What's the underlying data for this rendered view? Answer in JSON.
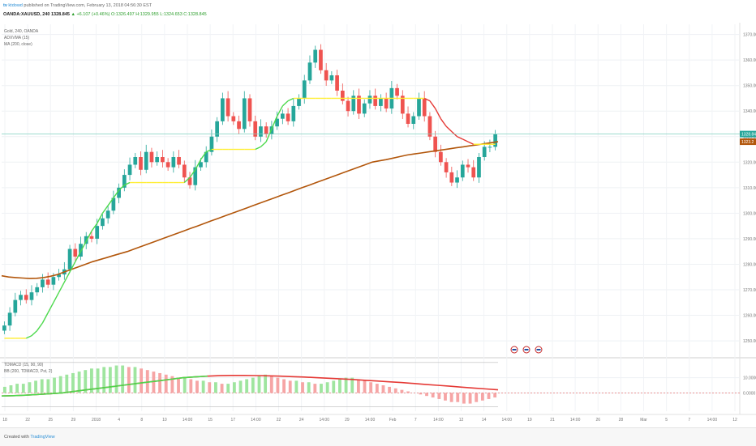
{
  "header": {
    "logo": "tv",
    "author": "ktdowd",
    "published_text": "published on TradingView.com, February 13, 2018 04:56:30 EST"
  },
  "quote": {
    "symbol": "OANDA:XAUUSD, 240",
    "open": "1328.845",
    "change": "▲ +6.107 (+0.46%)",
    "o": "O:1326.497",
    "h": "H:1329.955",
    "l": "L:1324.653",
    "c": "C:1328.845"
  },
  "legend": [
    "Gold, 240, OANDA",
    "ADXVMA (15)",
    "MA (200, close)"
  ],
  "lower_legend": [
    "TDMACD (15, 90, 90)",
    "BB (200, TDMACD, Pst, 2)"
  ],
  "footer": {
    "created": "Created with",
    "brand": "TradingView"
  },
  "chart_data": [
    {
      "type": "candlestick",
      "yticks": [
        "1370.00",
        "1360.00",
        "1350.00",
        "1340.00",
        "1330.00",
        "1320.00",
        "1310.00",
        "1300.00",
        "1290.00",
        "1280.00",
        "1270.00",
        "1260.00",
        "1250.00"
      ],
      "ytick_values": [
        1370,
        1360,
        1350,
        1340,
        1330,
        1320,
        1310,
        1300,
        1290,
        1280,
        1270,
        1260,
        1250
      ],
      "ylim": [
        1244,
        1374
      ],
      "last_price_label": "1328.845",
      "ma_price_label": "1323.2",
      "xticks": [
        "18",
        "22",
        "25",
        "29",
        "2018",
        "4",
        "8",
        "10",
        "14:00",
        "15",
        "17",
        "14:00",
        "22",
        "24",
        "14:00",
        "29",
        "14:00",
        "Feb",
        "7",
        "14:00",
        "12",
        "14",
        "14:00",
        "19",
        "21",
        "14:00",
        "26",
        "28",
        "Mar",
        "5",
        "7",
        "14:00",
        "12"
      ],
      "close_series": [
        1256,
        1261,
        1266,
        1268,
        1266,
        1269,
        1271,
        1274,
        1272,
        1275,
        1276,
        1278,
        1286,
        1283,
        1288,
        1291,
        1290,
        1295,
        1298,
        1301,
        1306,
        1310,
        1315,
        1319,
        1322,
        1317,
        1324,
        1320,
        1322,
        1320,
        1318,
        1322,
        1319,
        1314,
        1311,
        1318,
        1320,
        1324,
        1330,
        1336,
        1345,
        1338,
        1336,
        1333,
        1345,
        1336,
        1330,
        1334,
        1331,
        1334,
        1337,
        1339,
        1336,
        1342,
        1345,
        1352,
        1359,
        1364,
        1356,
        1352,
        1354,
        1348,
        1344,
        1340,
        1346,
        1339,
        1343,
        1346,
        1342,
        1345,
        1341,
        1349,
        1346,
        1339,
        1335,
        1338,
        1345,
        1338,
        1330,
        1324,
        1320,
        1316,
        1312,
        1314,
        1319,
        1318,
        1314,
        1322,
        1326,
        1326,
        1331
      ],
      "adxvma": [
        1251,
        1251,
        1251,
        1251,
        1251,
        1252,
        1254,
        1257,
        1261,
        1265,
        1269,
        1273,
        1277,
        1281,
        1285,
        1289,
        1293,
        1296,
        1300,
        1303,
        1306,
        1309,
        1311,
        1312,
        1312,
        1312,
        1312,
        1312,
        1312,
        1312,
        1312,
        1312,
        1312,
        1312,
        1314,
        1317,
        1321,
        1324,
        1325,
        1325,
        1325,
        1325,
        1325,
        1325,
        1325,
        1325,
        1325,
        1326,
        1328,
        1333,
        1338,
        1342,
        1344,
        1345,
        1345,
        1345,
        1345,
        1345,
        1345,
        1345,
        1345,
        1345,
        1345,
        1345,
        1345,
        1345,
        1345,
        1345,
        1345,
        1345,
        1345,
        1345,
        1345,
        1345,
        1345,
        1345,
        1345,
        1345,
        1344,
        1341,
        1337,
        1334,
        1332,
        1330,
        1329,
        1328,
        1327,
        1327,
        1327,
        1327,
        1327
      ],
      "ma200": [
        1275.5,
        1275,
        1274.8,
        1274.6,
        1274.4,
        1274.5,
        1274.8,
        1275.3,
        1276,
        1277,
        1278,
        1279,
        1280,
        1281,
        1281.8,
        1282.6,
        1283.4,
        1284.2,
        1285,
        1286,
        1287,
        1288,
        1289,
        1290,
        1291,
        1292,
        1293,
        1294,
        1295,
        1296,
        1297,
        1298,
        1299,
        1300,
        1301,
        1302,
        1303,
        1304,
        1305,
        1306,
        1307,
        1308,
        1309,
        1310,
        1311,
        1312,
        1313,
        1314,
        1315,
        1316,
        1317,
        1318,
        1319,
        1320,
        1320.5,
        1321,
        1321.6,
        1322.2,
        1322.8,
        1323.2,
        1323.6,
        1324,
        1324.4,
        1324.8,
        1325.2,
        1325.6,
        1326,
        1326.4,
        1326.8,
        1327.2,
        1327.6,
        1328
      ],
      "events_icons": 3
    },
    {
      "type": "histogram",
      "yticks": [
        "10.0000",
        "0.0000"
      ],
      "ytick_values": [
        10,
        0
      ],
      "ylim": [
        -12,
        22
      ],
      "histogram": [
        4,
        5,
        6,
        6,
        7,
        8,
        9,
        9,
        10,
        11,
        12,
        13,
        14,
        15,
        16,
        16,
        17,
        17,
        18,
        18,
        17,
        17,
        16,
        15,
        14,
        13,
        12,
        11,
        10,
        10,
        9,
        8,
        8,
        7,
        7,
        6,
        6,
        7,
        8,
        9,
        10,
        11,
        12,
        11,
        10,
        9,
        8,
        8,
        7,
        7,
        6,
        6,
        7,
        8,
        9,
        10,
        10,
        9,
        8,
        7,
        6,
        5,
        4,
        3,
        2,
        1,
        0,
        -1,
        -2,
        -3,
        -4,
        -5,
        -6,
        -6,
        -7,
        -7,
        -6,
        -5,
        -4,
        -3
      ],
      "signal": [
        -2,
        -1.8,
        -1.5,
        -1,
        -0.5,
        0,
        1,
        2,
        3,
        4,
        5,
        6,
        7,
        8,
        9,
        10,
        10.5,
        11,
        11.3,
        11.5,
        11.5,
        11.4,
        11.2,
        11,
        10.7,
        10.4,
        10,
        9.6,
        9.2,
        8.8,
        8.3,
        7.8,
        7.3,
        6.8,
        6.2,
        5.6,
        5,
        4.4,
        3.8,
        3.2,
        2.6,
        2
      ],
      "bb_upper": 20,
      "bb_lower": -9
    }
  ],
  "colors": {
    "bull": "#26a69a",
    "bear": "#ef5350",
    "ma200": "#b2560b",
    "adx_up": "#4cd94c",
    "adx_flat": "#ffee33",
    "adx_down": "#e53935",
    "hist_bull": "#9fe59f",
    "hist_bear": "#f6a5a5",
    "signal": "#e53935"
  }
}
